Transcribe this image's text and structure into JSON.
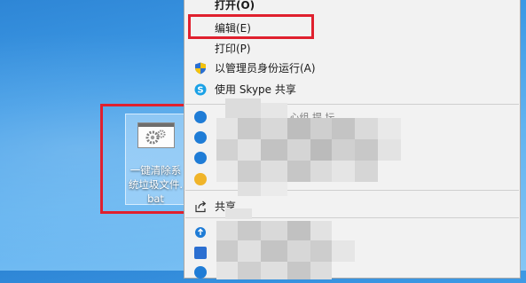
{
  "desktop": {
    "file": {
      "label_line1": "一键清除系",
      "label_line2": "统垃圾文件.",
      "label_line3": "bat"
    }
  },
  "context_menu": {
    "items": [
      {
        "label": "打开(O)",
        "bold": true,
        "icon": ""
      },
      {
        "label": "编辑(E)",
        "bold": false,
        "icon": ""
      },
      {
        "label": "打印(P)",
        "bold": false,
        "icon": ""
      },
      {
        "label": "以管理员身份运行(A)",
        "bold": false,
        "icon": "uac-shield-icon"
      },
      {
        "label": "使用 Skype 共享",
        "bold": false,
        "icon": "skype-icon"
      },
      {
        "label": "共享",
        "bold": false,
        "icon": "share-icon"
      }
    ],
    "obscured_text": "\" 心组 提 坛"
  },
  "colors": {
    "highlight_border": "#e0202e",
    "menu_bg": "#f2f2f2"
  }
}
